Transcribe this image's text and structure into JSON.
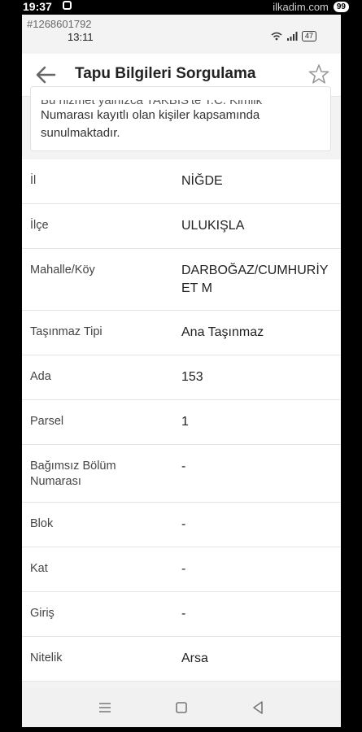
{
  "outer_status": {
    "time": "19:37",
    "battery": "99",
    "watermark": "ilkadim.com"
  },
  "screenshot": {
    "id": "#1268601792",
    "status_time": "13:11",
    "battery": "47"
  },
  "header": {
    "title": "Tapu Bilgileri Sorgulama"
  },
  "info": {
    "line1": "Bu hizmet yalnızca TAKBİS'te T.C. Kimlik",
    "line2": "Numarası kayıtlı olan kişiler kapsamında",
    "line3": "sunulmaktadır."
  },
  "rows": [
    {
      "label": "İl",
      "value": "NİĞDE"
    },
    {
      "label": "İlçe",
      "value": "ULUKIŞLA"
    },
    {
      "label": "Mahalle/Köy",
      "value": "DARBOĞAZ/CUMHURİY ET M"
    },
    {
      "label": "Taşınmaz Tipi",
      "value": "Ana Taşınmaz"
    },
    {
      "label": "Ada",
      "value": "153"
    },
    {
      "label": "Parsel",
      "value": "1"
    },
    {
      "label": "Bağımsız Bölüm Numarası",
      "value": "-"
    },
    {
      "label": "Blok",
      "value": "-"
    },
    {
      "label": "Kat",
      "value": "-"
    },
    {
      "label": "Giriş",
      "value": "-"
    },
    {
      "label": "Nitelik",
      "value": "Arsa"
    }
  ]
}
